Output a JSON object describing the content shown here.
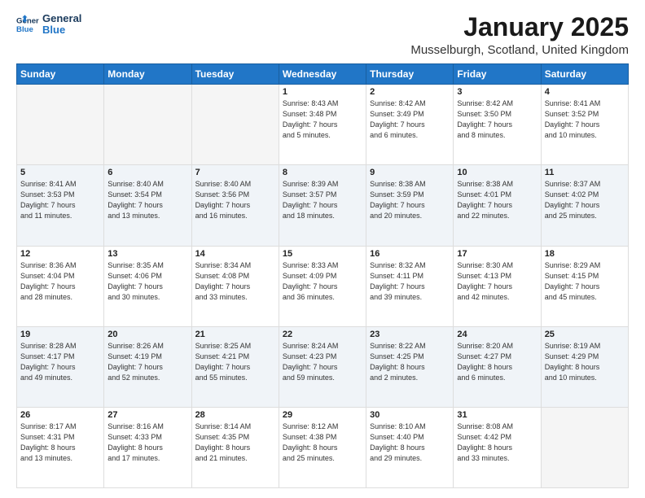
{
  "header": {
    "logo_line1": "General",
    "logo_line2": "Blue",
    "month": "January 2025",
    "location": "Musselburgh, Scotland, United Kingdom"
  },
  "days_of_week": [
    "Sunday",
    "Monday",
    "Tuesday",
    "Wednesday",
    "Thursday",
    "Friday",
    "Saturday"
  ],
  "weeks": [
    [
      {
        "day": "",
        "text": ""
      },
      {
        "day": "",
        "text": ""
      },
      {
        "day": "",
        "text": ""
      },
      {
        "day": "1",
        "text": "Sunrise: 8:43 AM\nSunset: 3:48 PM\nDaylight: 7 hours\nand 5 minutes."
      },
      {
        "day": "2",
        "text": "Sunrise: 8:42 AM\nSunset: 3:49 PM\nDaylight: 7 hours\nand 6 minutes."
      },
      {
        "day": "3",
        "text": "Sunrise: 8:42 AM\nSunset: 3:50 PM\nDaylight: 7 hours\nand 8 minutes."
      },
      {
        "day": "4",
        "text": "Sunrise: 8:41 AM\nSunset: 3:52 PM\nDaylight: 7 hours\nand 10 minutes."
      }
    ],
    [
      {
        "day": "5",
        "text": "Sunrise: 8:41 AM\nSunset: 3:53 PM\nDaylight: 7 hours\nand 11 minutes."
      },
      {
        "day": "6",
        "text": "Sunrise: 8:40 AM\nSunset: 3:54 PM\nDaylight: 7 hours\nand 13 minutes."
      },
      {
        "day": "7",
        "text": "Sunrise: 8:40 AM\nSunset: 3:56 PM\nDaylight: 7 hours\nand 16 minutes."
      },
      {
        "day": "8",
        "text": "Sunrise: 8:39 AM\nSunset: 3:57 PM\nDaylight: 7 hours\nand 18 minutes."
      },
      {
        "day": "9",
        "text": "Sunrise: 8:38 AM\nSunset: 3:59 PM\nDaylight: 7 hours\nand 20 minutes."
      },
      {
        "day": "10",
        "text": "Sunrise: 8:38 AM\nSunset: 4:01 PM\nDaylight: 7 hours\nand 22 minutes."
      },
      {
        "day": "11",
        "text": "Sunrise: 8:37 AM\nSunset: 4:02 PM\nDaylight: 7 hours\nand 25 minutes."
      }
    ],
    [
      {
        "day": "12",
        "text": "Sunrise: 8:36 AM\nSunset: 4:04 PM\nDaylight: 7 hours\nand 28 minutes."
      },
      {
        "day": "13",
        "text": "Sunrise: 8:35 AM\nSunset: 4:06 PM\nDaylight: 7 hours\nand 30 minutes."
      },
      {
        "day": "14",
        "text": "Sunrise: 8:34 AM\nSunset: 4:08 PM\nDaylight: 7 hours\nand 33 minutes."
      },
      {
        "day": "15",
        "text": "Sunrise: 8:33 AM\nSunset: 4:09 PM\nDaylight: 7 hours\nand 36 minutes."
      },
      {
        "day": "16",
        "text": "Sunrise: 8:32 AM\nSunset: 4:11 PM\nDaylight: 7 hours\nand 39 minutes."
      },
      {
        "day": "17",
        "text": "Sunrise: 8:30 AM\nSunset: 4:13 PM\nDaylight: 7 hours\nand 42 minutes."
      },
      {
        "day": "18",
        "text": "Sunrise: 8:29 AM\nSunset: 4:15 PM\nDaylight: 7 hours\nand 45 minutes."
      }
    ],
    [
      {
        "day": "19",
        "text": "Sunrise: 8:28 AM\nSunset: 4:17 PM\nDaylight: 7 hours\nand 49 minutes."
      },
      {
        "day": "20",
        "text": "Sunrise: 8:26 AM\nSunset: 4:19 PM\nDaylight: 7 hours\nand 52 minutes."
      },
      {
        "day": "21",
        "text": "Sunrise: 8:25 AM\nSunset: 4:21 PM\nDaylight: 7 hours\nand 55 minutes."
      },
      {
        "day": "22",
        "text": "Sunrise: 8:24 AM\nSunset: 4:23 PM\nDaylight: 7 hours\nand 59 minutes."
      },
      {
        "day": "23",
        "text": "Sunrise: 8:22 AM\nSunset: 4:25 PM\nDaylight: 8 hours\nand 2 minutes."
      },
      {
        "day": "24",
        "text": "Sunrise: 8:20 AM\nSunset: 4:27 PM\nDaylight: 8 hours\nand 6 minutes."
      },
      {
        "day": "25",
        "text": "Sunrise: 8:19 AM\nSunset: 4:29 PM\nDaylight: 8 hours\nand 10 minutes."
      }
    ],
    [
      {
        "day": "26",
        "text": "Sunrise: 8:17 AM\nSunset: 4:31 PM\nDaylight: 8 hours\nand 13 minutes."
      },
      {
        "day": "27",
        "text": "Sunrise: 8:16 AM\nSunset: 4:33 PM\nDaylight: 8 hours\nand 17 minutes."
      },
      {
        "day": "28",
        "text": "Sunrise: 8:14 AM\nSunset: 4:35 PM\nDaylight: 8 hours\nand 21 minutes."
      },
      {
        "day": "29",
        "text": "Sunrise: 8:12 AM\nSunset: 4:38 PM\nDaylight: 8 hours\nand 25 minutes."
      },
      {
        "day": "30",
        "text": "Sunrise: 8:10 AM\nSunset: 4:40 PM\nDaylight: 8 hours\nand 29 minutes."
      },
      {
        "day": "31",
        "text": "Sunrise: 8:08 AM\nSunset: 4:42 PM\nDaylight: 8 hours\nand 33 minutes."
      },
      {
        "day": "",
        "text": ""
      }
    ]
  ]
}
